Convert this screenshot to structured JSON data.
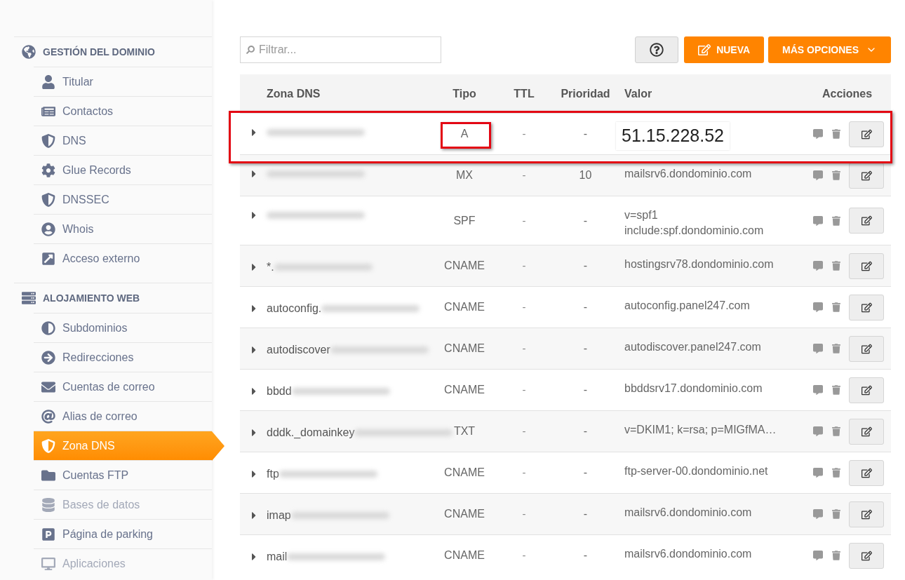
{
  "sidebar": {
    "sections": [
      {
        "title": "GESTIÓN DEL DOMINIO",
        "items": [
          {
            "label": "Titular",
            "selected": false,
            "disabled": false
          },
          {
            "label": "Contactos",
            "selected": false,
            "disabled": false
          },
          {
            "label": "DNS",
            "selected": false,
            "disabled": false
          },
          {
            "label": "Glue Records",
            "selected": false,
            "disabled": false
          },
          {
            "label": "DNSSEC",
            "selected": false,
            "disabled": false
          },
          {
            "label": "Whois",
            "selected": false,
            "disabled": false
          },
          {
            "label": "Acceso externo",
            "selected": false,
            "disabled": false
          }
        ]
      },
      {
        "title": "ALOJAMIENTO WEB",
        "items": [
          {
            "label": "Subdominios",
            "selected": false,
            "disabled": false
          },
          {
            "label": "Redirecciones",
            "selected": false,
            "disabled": false
          },
          {
            "label": "Cuentas de correo",
            "selected": false,
            "disabled": false
          },
          {
            "label": "Alias de correo",
            "selected": false,
            "disabled": false
          },
          {
            "label": "Zona DNS",
            "selected": true,
            "disabled": false
          },
          {
            "label": "Cuentas FTP",
            "selected": false,
            "disabled": false
          },
          {
            "label": "Bases de datos",
            "selected": false,
            "disabled": true
          },
          {
            "label": "Página de parking",
            "selected": false,
            "disabled": false
          },
          {
            "label": "Aplicaciones",
            "selected": false,
            "disabled": true
          }
        ]
      }
    ]
  },
  "toolbar": {
    "search": {
      "placeholder": "Filtrar..."
    },
    "buttons": [
      {
        "kind": "help"
      },
      {
        "kind": "primary",
        "label": "NUEVA"
      },
      {
        "kind": "dropdown",
        "label": "MÁS OPCIONES"
      }
    ]
  },
  "table": {
    "columns": [
      "Zona DNS",
      "Tipo",
      "TTL",
      "Prioridad",
      "Valor",
      "Acciones"
    ],
    "rows": [
      {
        "name": "",
        "redacted": true,
        "type": "A",
        "ttl": "-",
        "priority": "-",
        "value": [
          "51.15.228.52"
        ],
        "highlighted": true
      },
      {
        "name": "",
        "redacted": true,
        "type": "MX",
        "ttl": "-",
        "priority": "10",
        "value": [
          "mailsrv6.dondominio.com"
        ],
        "highlighted": false
      },
      {
        "name": "",
        "redacted": true,
        "type": "SPF",
        "ttl": "-",
        "priority": "-",
        "value": [
          "v=spf1",
          "include:spf.dondominio.com"
        ],
        "highlighted": false
      },
      {
        "name": "*.",
        "redacted": true,
        "type": "CNAME",
        "ttl": "-",
        "priority": "-",
        "value": [
          "hostingsrv78.dondominio.com"
        ],
        "highlighted": false
      },
      {
        "name": "autoconfig.",
        "redacted": true,
        "type": "CNAME",
        "ttl": "-",
        "priority": "-",
        "value": [
          "autoconfig.panel247.com"
        ],
        "highlighted": false
      },
      {
        "name": "autodiscover",
        "redacted": true,
        "type": "CNAME",
        "ttl": "-",
        "priority": "-",
        "value": [
          "autodiscover.panel247.com"
        ],
        "highlighted": false
      },
      {
        "name": "bbdd",
        "redacted": true,
        "type": "CNAME",
        "ttl": "-",
        "priority": "-",
        "value": [
          "bbddsrv17.dondominio.com"
        ],
        "highlighted": false
      },
      {
        "name": "dddk._domainkey",
        "redacted": true,
        "type": "TXT",
        "ttl": "-",
        "priority": "-",
        "value": [
          "v=DKIM1; k=rsa; p=MIGfMA…"
        ],
        "highlighted": false
      },
      {
        "name": "ftp",
        "redacted": true,
        "type": "CNAME",
        "ttl": "-",
        "priority": "-",
        "value": [
          "ftp-server-00.dondominio.net"
        ],
        "highlighted": false
      },
      {
        "name": "imap",
        "redacted": true,
        "type": "CNAME",
        "ttl": "-",
        "priority": "-",
        "value": [
          "mailsrv6.dondominio.com"
        ],
        "highlighted": false
      },
      {
        "name": "mail",
        "redacted": true,
        "type": "CNAME",
        "ttl": "-",
        "priority": "-",
        "value": [
          "mailsrv6.dondominio.com"
        ],
        "highlighted": false
      }
    ]
  }
}
